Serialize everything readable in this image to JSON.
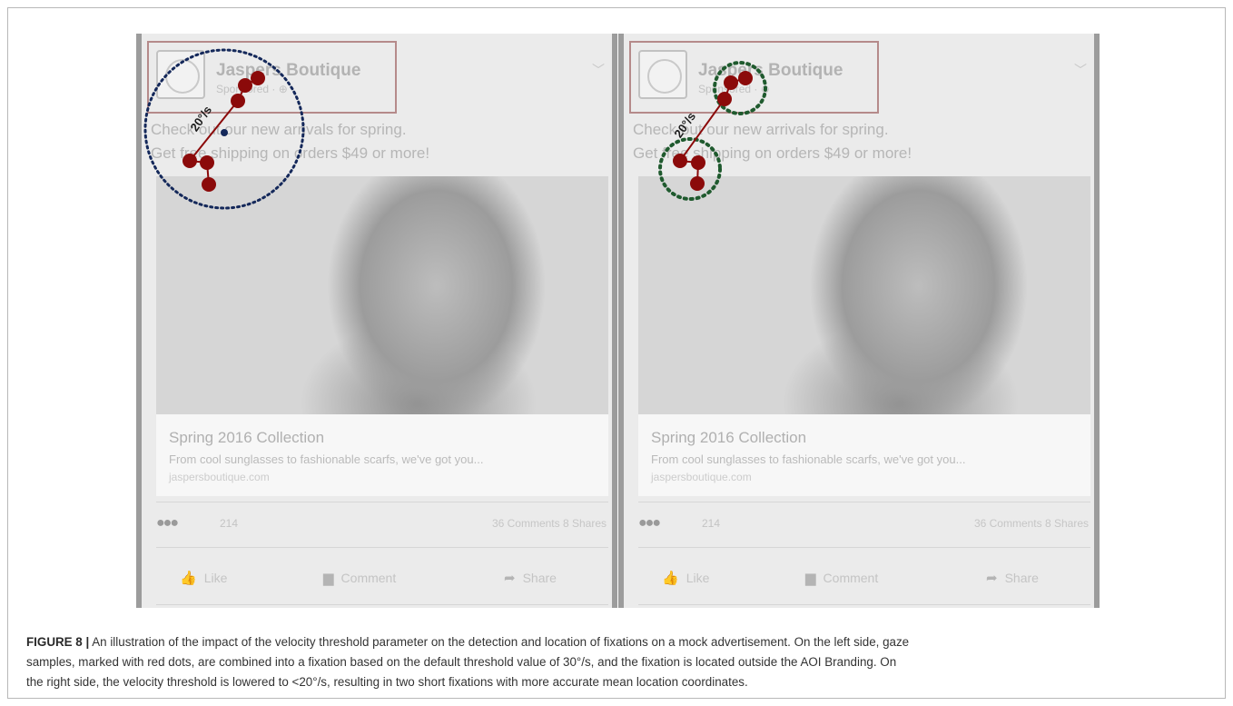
{
  "figure": {
    "label": "FIGURE 8 |",
    "caption": "An illustration of the impact of the velocity threshold parameter on the detection and location of fixations on a mock advertisement. On the left side, gaze\nsamples, marked with red dots, are combined into a fixation based on the default threshold value of 30°/s, and the fixation is located outside the AOI Branding. On\nthe right side, the velocity threshold is lowered to <20°/s, resulting in two short fixations with more accurate mean location coordinates."
  },
  "panels": [
    {
      "id": "left",
      "page_name": "Jaspers Boutique",
      "sponsored": "Sponsored · ⊕",
      "text_line1": "Check out our new arrivals for spring.",
      "text_line2": "Get free shipping on orders $49 or more!",
      "link_title": "Spring 2016 Collection",
      "link_desc": "From cool sunglasses to fashionable scarfs, we've got you...",
      "link_url": "jaspersboutique.com",
      "reaction_count": "214",
      "stats": "36 Comments   8 Shares",
      "like": "Like",
      "comment": "Comment",
      "share": "Share",
      "velocity_label": "20°/s"
    },
    {
      "id": "right",
      "page_name": "Jaspers Boutique",
      "sponsored": "Sponsored · ⊕",
      "text_line1": "Check out our new arrivals for spring.",
      "text_line2": "Get free shipping on orders $49 or more!",
      "link_title": "Spring 2016 Collection",
      "link_desc": "From cool sunglasses to fashionable scarfs, we've got you...",
      "link_url": "jaspersboutique.com",
      "reaction_count": "214",
      "stats": "36 Comments   8 Shares",
      "like": "Like",
      "comment": "Comment",
      "share": "Share",
      "velocity_label": "20°/s"
    }
  ],
  "colors": {
    "gaze_sample": "#8b0a0a",
    "fixation_default": "#14285a",
    "fixation_lowered": "#1f5a2e",
    "aoi_border": "#b58a8a"
  }
}
